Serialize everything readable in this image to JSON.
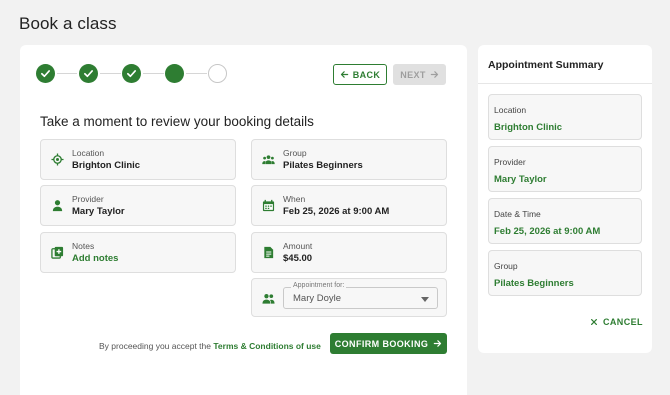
{
  "page": {
    "title": "Book a class"
  },
  "stepper": {
    "steps": [
      {
        "state": "completed",
        "icon": "check-icon"
      },
      {
        "state": "completed",
        "icon": "check-icon"
      },
      {
        "state": "completed",
        "icon": "check-icon"
      },
      {
        "state": "current",
        "icon": ""
      },
      {
        "state": "upcoming",
        "icon": ""
      }
    ]
  },
  "nav": {
    "back_label": "BACK",
    "next_label": "NEXT"
  },
  "review": {
    "heading": "Take a moment to review your booking details",
    "location": {
      "label": "Location",
      "value": "Brighton Clinic",
      "icon": "location-target-icon"
    },
    "provider": {
      "label": "Provider",
      "value": "Mary Taylor",
      "icon": "person-icon"
    },
    "notes": {
      "label": "Notes",
      "value": "Add notes",
      "icon": "add-note-icon"
    },
    "group": {
      "label": "Group",
      "value": "Pilates Beginners",
      "icon": "group-icon"
    },
    "when": {
      "label": "When",
      "value": "Feb 25, 2026 at 9:00 AM",
      "icon": "calendar-icon"
    },
    "amount": {
      "label": "Amount",
      "value": "$45.00",
      "icon": "receipt-icon"
    },
    "appointment_for": {
      "label": "Appointment for:",
      "value": "Mary Doyle",
      "icon": "people-icon"
    }
  },
  "footer": {
    "terms_prefix": "By proceeding you accept the ",
    "terms_link": "Terms & Conditions of use",
    "confirm_label": "CONFIRM BOOKING"
  },
  "summary": {
    "title": "Appointment Summary",
    "items": [
      {
        "label": "Location",
        "value": "Brighton Clinic"
      },
      {
        "label": "Provider",
        "value": "Mary Taylor"
      },
      {
        "label": "Date & Time",
        "value": "Feb 25, 2026 at 9:00 AM"
      },
      {
        "label": "Group",
        "value": "Pilates Beginners"
      }
    ],
    "cancel_label": "CANCEL"
  },
  "colors": {
    "accent": "#2e7d32",
    "page_bg": "#f2f2f2",
    "tile_bg": "#f7f7f7",
    "disabled": "#e0e0e0"
  }
}
